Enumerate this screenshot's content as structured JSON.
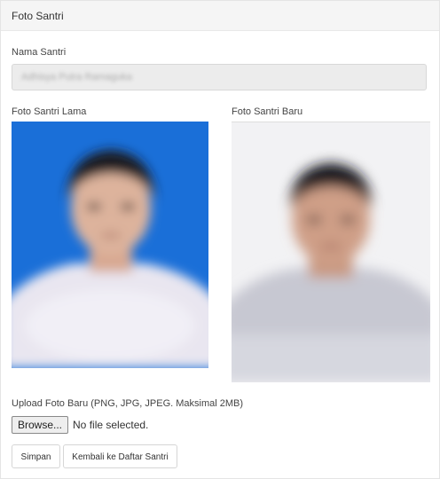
{
  "panel": {
    "title": "Foto Santri"
  },
  "form": {
    "name_label": "Nama Santri",
    "name_value": "Adhisya Putra Ramaguka",
    "old_photo_label": "Foto Santri Lama",
    "new_photo_label": "Foto Santri Baru",
    "upload_label": "Upload Foto Baru (PNG, JPG, JPEG. Maksimal 2MB)",
    "browse_label": "Browse...",
    "file_status": "No file selected.",
    "save_label": "Simpan",
    "back_label": "Kembali ke Daftar Santri"
  },
  "colors": {
    "old_photo_bg": "#1a6fd8",
    "new_photo_bg": "#f2f2f4"
  }
}
